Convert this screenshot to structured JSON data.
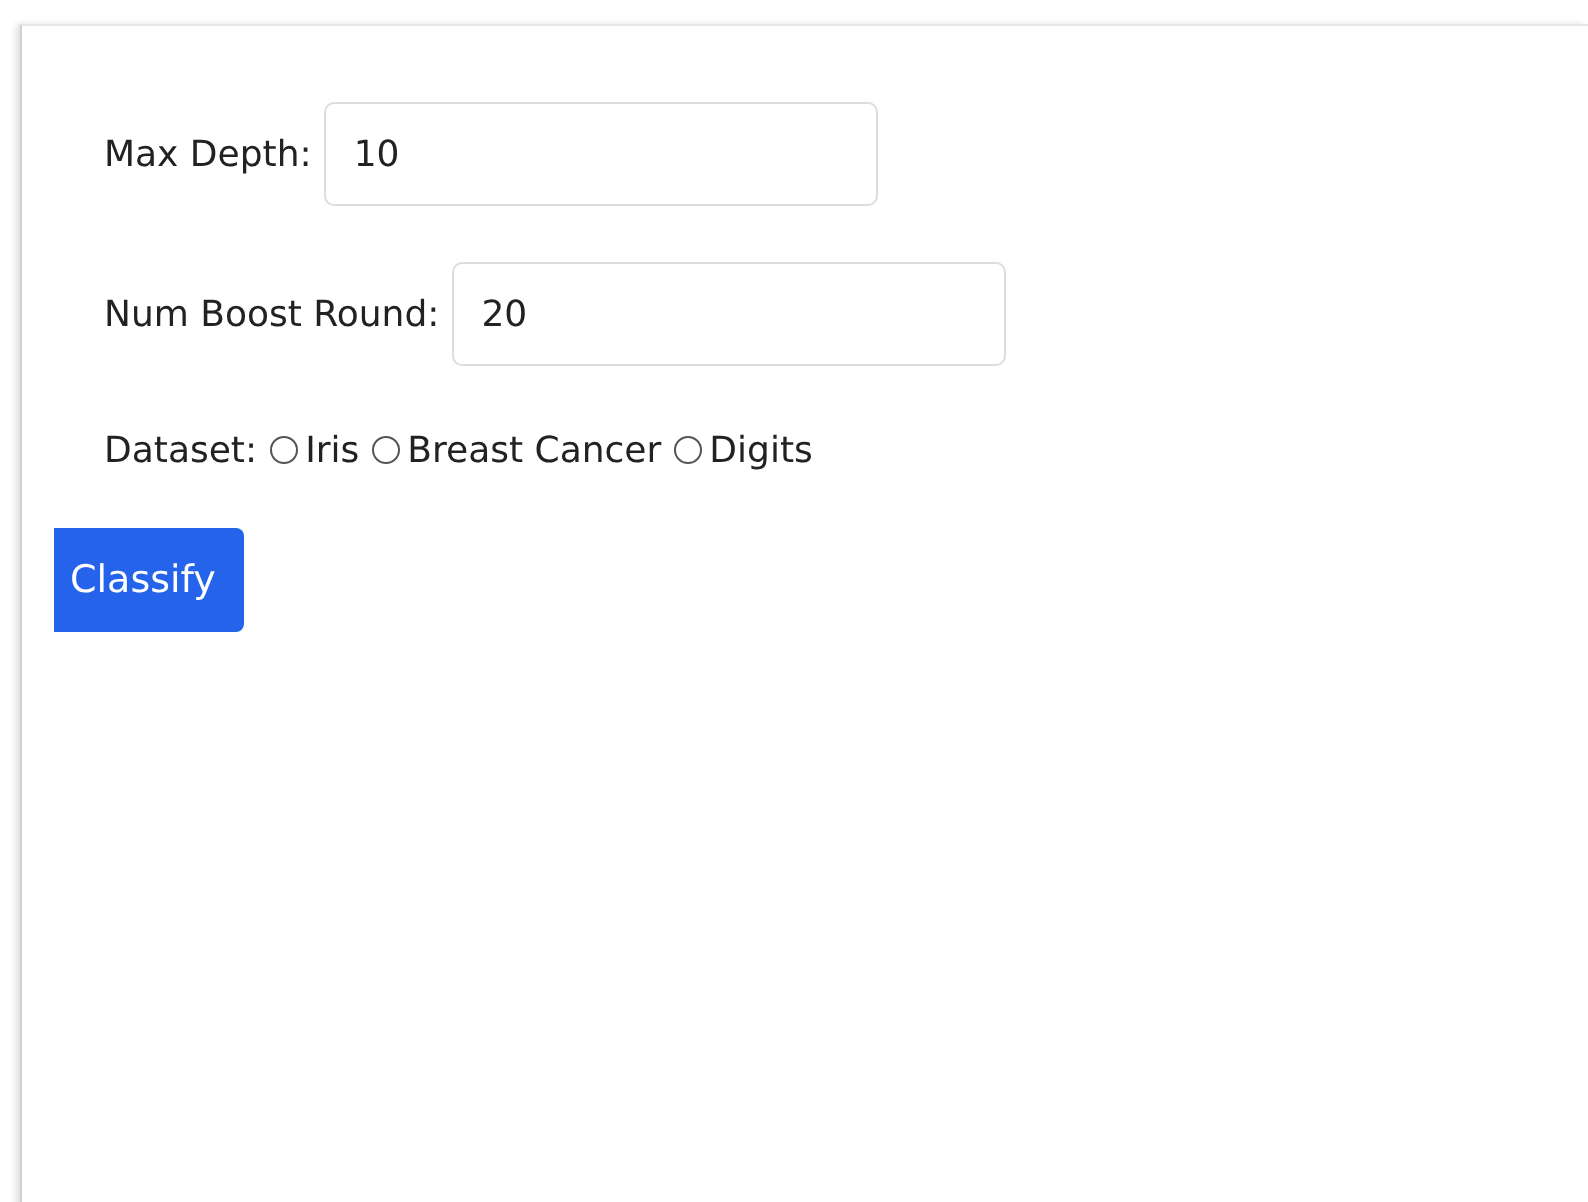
{
  "fields": [
    {
      "label": "Max Depth:",
      "value": "10"
    },
    {
      "label": "Num Boost Round:",
      "value": "20"
    }
  ],
  "dataset": {
    "label": "Dataset:",
    "options": [
      {
        "label": "Iris",
        "selected": false
      },
      {
        "label": "Breast Cancer",
        "selected": false
      },
      {
        "label": "Digits",
        "selected": false
      }
    ]
  },
  "button": "Classify"
}
